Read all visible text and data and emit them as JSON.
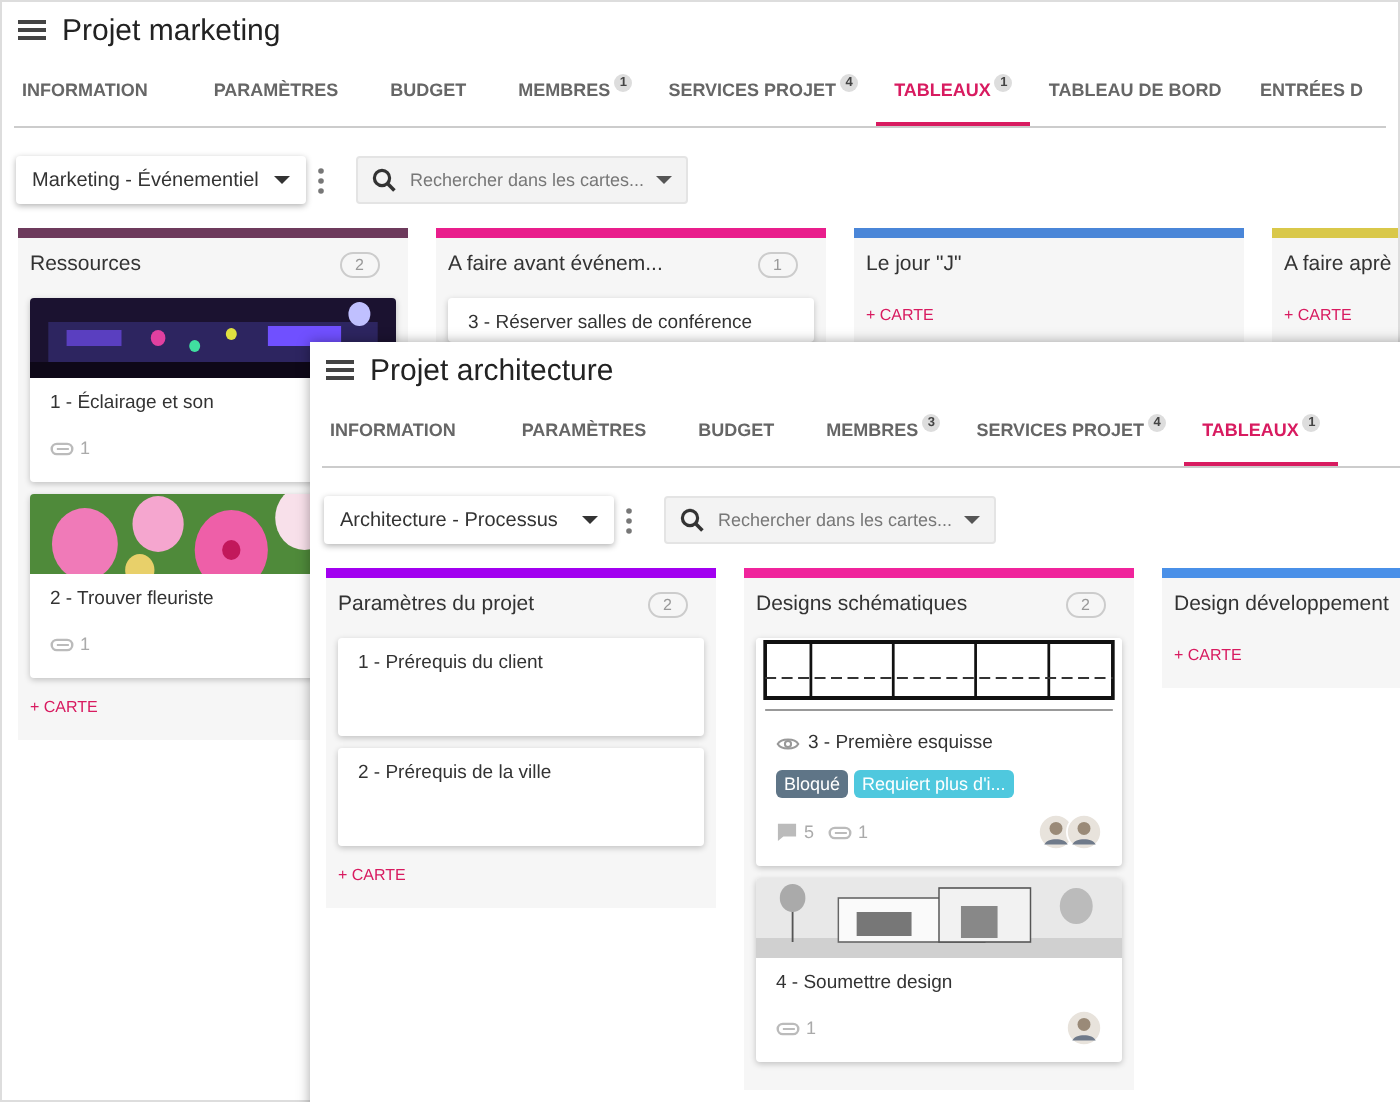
{
  "windows": [
    {
      "title": "Projet marketing",
      "tabs": [
        {
          "label": "INFORMATION",
          "selected": false
        },
        {
          "label": "PARAMÈTRES",
          "selected": false
        },
        {
          "label": "BUDGET",
          "selected": false
        },
        {
          "label": "MEMBRES",
          "badge": "1",
          "selected": false
        },
        {
          "label": "SERVICES PROJET",
          "badge": "4",
          "selected": false
        },
        {
          "label": "TABLEAUX",
          "badge": "1",
          "selected": true
        },
        {
          "label": "TABLEAU DE BORD",
          "selected": false
        },
        {
          "label": "ENTRÉES D",
          "selected": false
        }
      ],
      "board_selector": "Marketing - Événementiel",
      "search": {
        "placeholder": "Rechercher dans les cartes..."
      },
      "columns": [
        {
          "title": "Ressources",
          "count": "2",
          "color": "#6d3a5c",
          "cards": [
            {
              "picture": {
                "kind": "picture"
              },
              "watching": false,
              "title": "1 -  Éclairage et son",
              "attachments": "1"
            },
            {
              "picture": {
                "kind": "picture"
              },
              "watching": false,
              "title": "2 -  Trouver fleuriste",
              "attachments": "1"
            }
          ],
          "add_label": "+ CARTE"
        },
        {
          "title": "A faire avant événem...",
          "count": "1",
          "color": "#e91e8c",
          "cards": [
            {
              "watching": false,
              "title": "3 -  Réserver salles de conférence"
            }
          ]
        },
        {
          "title": "Le jour \"J\"",
          "color": "#4a86d8",
          "add_label": "+ CARTE"
        },
        {
          "title": "A faire aprè",
          "color": "#d9c84a",
          "add_label": "+ CARTE"
        }
      ]
    },
    {
      "title": "Projet architecture",
      "tabs": [
        {
          "label": "INFORMATION",
          "selected": false
        },
        {
          "label": "PARAMÈTRES",
          "selected": false
        },
        {
          "label": "BUDGET",
          "selected": false
        },
        {
          "label": "MEMBRES",
          "badge": "3",
          "selected": false
        },
        {
          "label": "SERVICES PROJET",
          "badge": "4",
          "selected": false
        },
        {
          "label": "TABLEAUX",
          "badge": "1",
          "selected": true
        }
      ],
      "board_selector": "Architecture - Processus",
      "search": {
        "placeholder": "Rechercher dans les cartes..."
      },
      "columns": [
        {
          "title": "Paramètres du projet",
          "count": "2",
          "color": "#a200f0",
          "cards": [
            {
              "watching": false,
              "title": "1 -  Prérequis du client"
            },
            {
              "watching": false,
              "title": "2 -  Prérequis de la ville"
            }
          ],
          "add_label": "+ CARTE"
        },
        {
          "title": "Designs schématiques",
          "count": "2",
          "color": "#f0249c",
          "cards": [
            {
              "picture": {
                "kind": "picture"
              },
              "watching": true,
              "title": "3 -  Première esquisse",
              "tags": [
                {
                  "label": "Bloqué",
                  "color": "#5f7587"
                },
                {
                  "label": "Requiert plus d'i...",
                  "color": "#4fc8de"
                }
              ],
              "comments": "5",
              "attachments": "1",
              "avatars": [
                {
                  "kind": "avatar"
                },
                {
                  "kind": "avatar"
                }
              ]
            },
            {
              "picture": {
                "kind": "picture"
              },
              "watching": false,
              "title": "4 -  Soumettre design",
              "attachments": "1",
              "avatars": [
                {
                  "kind": "avatar"
                }
              ]
            }
          ]
        },
        {
          "title": "Design développement",
          "color": "#4a90e8",
          "add_label": "+ CARTE"
        }
      ]
    }
  ]
}
